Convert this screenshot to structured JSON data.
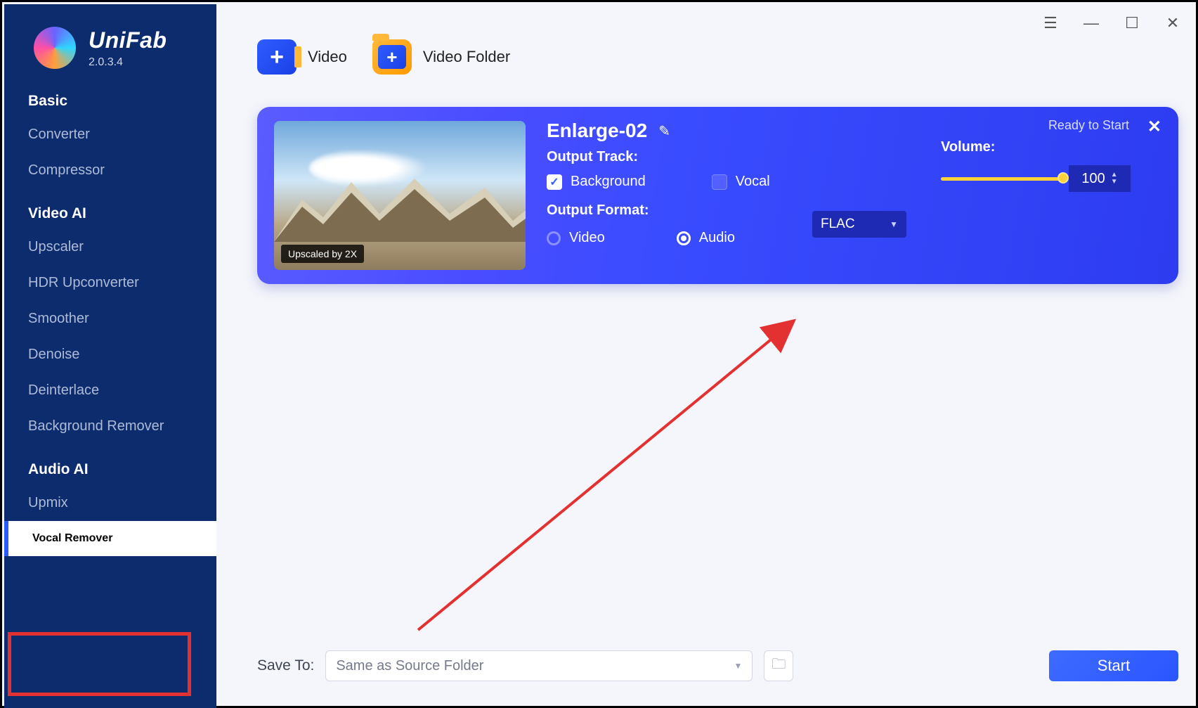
{
  "app": {
    "name": "UniFab",
    "version": "2.0.3.4"
  },
  "sidebar": {
    "sections": [
      {
        "title": "Basic",
        "items": [
          "Converter",
          "Compressor"
        ]
      },
      {
        "title": "Video AI",
        "items": [
          "Upscaler",
          "HDR Upconverter",
          "Smoother",
          "Denoise",
          "Deinterlace",
          "Background Remover"
        ]
      },
      {
        "title": "Audio AI",
        "items": [
          "Upmix",
          "Vocal Remover"
        ]
      }
    ],
    "active": "Vocal Remover"
  },
  "toolbar": {
    "video": "Video",
    "video_folder": "Video Folder"
  },
  "task": {
    "status": "Ready to Start",
    "title": "Enlarge-02",
    "thumb_badge": "Upscaled by 2X",
    "output_track_label": "Output Track:",
    "track_background": "Background",
    "track_vocal": "Vocal",
    "track_background_checked": true,
    "track_vocal_checked": false,
    "volume_label": "Volume:",
    "volume_value": "100",
    "output_format_label": "Output Format:",
    "format_video": "Video",
    "format_audio": "Audio",
    "format_selected": "audio",
    "format_dropdown": "FLAC"
  },
  "bottom": {
    "save_to_label": "Save To:",
    "save_to_value": "Same as Source Folder",
    "start": "Start"
  }
}
